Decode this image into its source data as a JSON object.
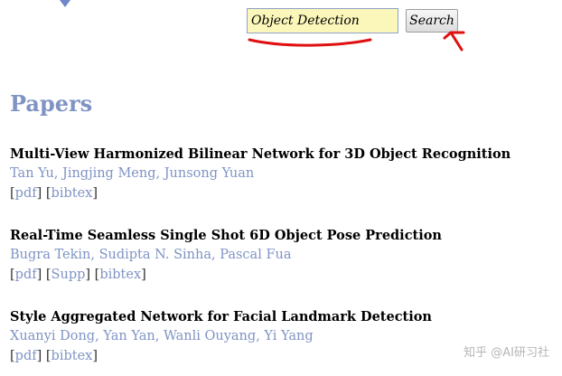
{
  "search": {
    "value": "Object Detection",
    "button_label": "Search"
  },
  "section_title": "Papers",
  "papers": [
    {
      "title": "Multi-View Harmonized Bilinear Network for 3D Object Recognition",
      "authors": [
        "Tan Yu",
        "Jingjing Meng",
        "Junsong Yuan"
      ],
      "links": [
        "pdf",
        "bibtex"
      ]
    },
    {
      "title": "Real-Time Seamless Single Shot 6D Object Pose Prediction",
      "authors": [
        "Bugra Tekin",
        "Sudipta N. Sinha",
        "Pascal Fua"
      ],
      "links": [
        "pdf",
        "Supp",
        "bibtex"
      ]
    },
    {
      "title": "Style Aggregated Network for Facial Landmark Detection",
      "authors": [
        "Xuanyi Dong",
        "Yan Yan",
        "Wanli Ouyang",
        "Yi Yang"
      ],
      "links": [
        "pdf",
        "bibtex"
      ]
    }
  ],
  "watermark": "知乎 @AI研习社",
  "colors": {
    "link": "#7f93c4",
    "input_background": "#fbf7ba",
    "annotation": "#e01010"
  }
}
